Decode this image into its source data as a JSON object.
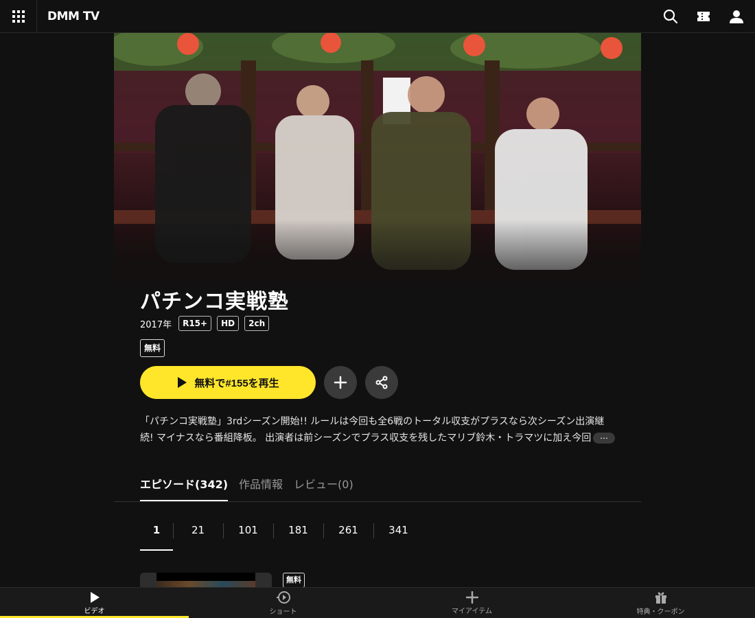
{
  "header": {
    "logo": "DMM TV",
    "icons": [
      "grid-icon",
      "search-icon",
      "ticket-icon",
      "user-icon"
    ]
  },
  "hero": {
    "image": "promotional-photo-four-presenters"
  },
  "title": "パチンコ実戦塾",
  "meta": {
    "year": "2017年",
    "tags": [
      "R15+",
      "HD",
      "2ch"
    ]
  },
  "free_badge": "無料",
  "actions": {
    "play_label": "無料で#155を再生",
    "icons": [
      "play-icon",
      "plus-icon",
      "share-icon"
    ]
  },
  "description": "「パチンコ実戦塾」3rdシーズン開始!! ルールは今回も全6戦のトータル収支がプラスなら次シーズン出演継続! マイナスなら番組降板。 出演者は前シーズンでプラス収支を残したマリブ鈴木・トラマツに加え今回",
  "more_label": "⋯",
  "tabs": [
    {
      "label": "エピソード(342)"
    },
    {
      "label": "作品情報"
    },
    {
      "label": "レビュー(0)"
    }
  ],
  "pages": [
    "1",
    "21",
    "101",
    "181",
    "261",
    "341"
  ],
  "episode": {
    "free_badge": "無料"
  },
  "bottom_nav": [
    {
      "label": "ビデオ",
      "icon": "play-icon"
    },
    {
      "label": "ショート",
      "icon": "short-play-icon"
    },
    {
      "label": "マイアイテム",
      "icon": "plus-icon"
    },
    {
      "label": "特典・クーポン",
      "icon": "gift-icon"
    }
  ],
  "colors": {
    "accent": "#ffe62b",
    "background": "#111111"
  }
}
